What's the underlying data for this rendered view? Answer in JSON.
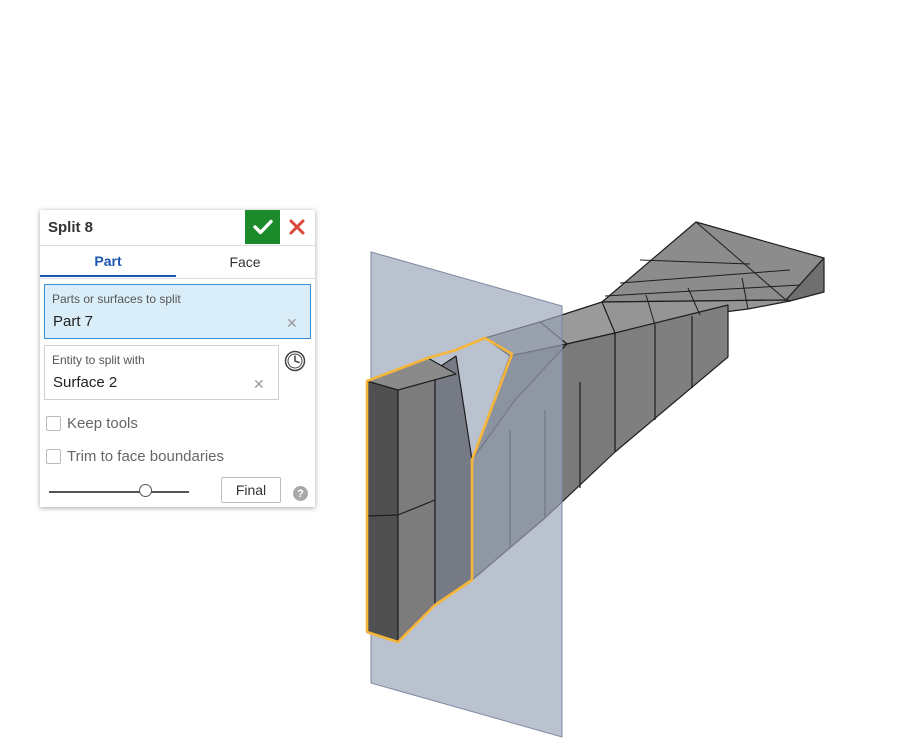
{
  "feature_panel": {
    "title": "Split 8",
    "accept_icon": "checkmark-icon",
    "cancel_icon": "close-icon",
    "tabs": [
      {
        "label": "Part",
        "active": true
      },
      {
        "label": "Face",
        "active": false
      }
    ],
    "parts_field": {
      "label": "Parts or surfaces to split",
      "value": "Part 7"
    },
    "entity_field": {
      "label": "Entity to split with",
      "value": "Surface 2"
    },
    "clock_icon": "clock-icon",
    "options": [
      {
        "label": "Keep tools",
        "checked": false
      },
      {
        "label": "Trim to face boundaries",
        "checked": false
      }
    ],
    "slider": {
      "value": 0.69
    },
    "final_label": "Final",
    "help_symbol": "?"
  },
  "colors": {
    "accept_green": "#1a8a2a",
    "cancel_red": "#d9473a",
    "tab_active_blue": "#1a55b0",
    "selection_fill": "#daeef9",
    "selection_border": "#3a8fd8",
    "highlight_orange": "#f5b63a",
    "plane_gray": "#9aa3b8"
  }
}
